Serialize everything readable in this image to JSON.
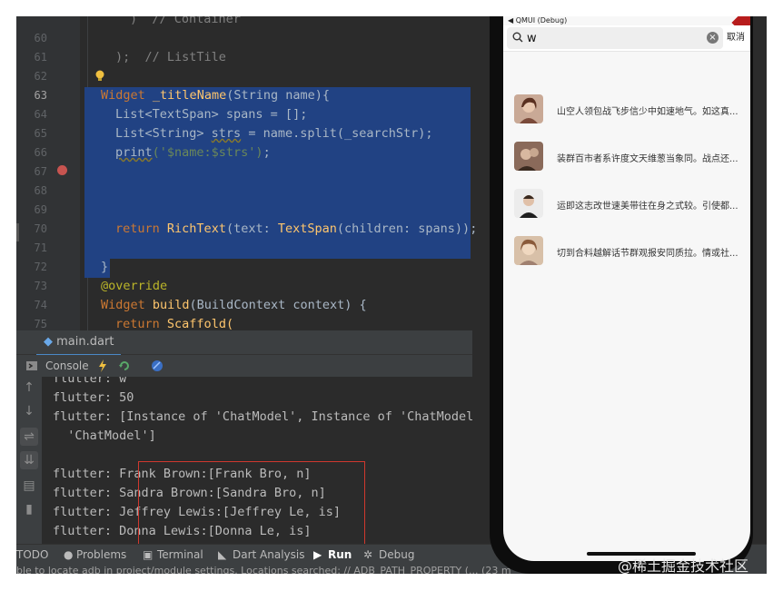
{
  "editor": {
    "line_numbers": [
      "60",
      "61",
      "62",
      "63",
      "64",
      "65",
      "66",
      "67",
      "68",
      "69",
      "70",
      "71",
      "72",
      "73",
      "74",
      "75"
    ],
    "partial_top": ")  // Container",
    "lines": {
      "l60": ");  // ListTile",
      "l63_kw": "Widget",
      "l63_fn": "_titleName",
      "l63_rest": "(String name){",
      "l64": "List<TextSpan> spans = [];",
      "l65_a": "List<String> ",
      "l65_b": "strs",
      "l65_c": " = name.split(_searchStr);",
      "l66_fn": "print",
      "l66_str": "('$name:$strs')",
      "l66_end": ";",
      "l70_kw": "return",
      "l70_fn": "RichText",
      "l70_a": "(text: ",
      "l70_fn2": "TextSpan",
      "l70_b": "(children: spans));",
      "l72": "}",
      "l73": "@override",
      "l74_a": "Widget ",
      "l74_fn": "build",
      "l74_b": "(BuildContext context) {",
      "l75_kw": "return",
      "l75_fn": "Scaffold("
    }
  },
  "tabs": {
    "file_tab": "main.dart"
  },
  "console_bar": {
    "label": "Console"
  },
  "console": {
    "lines": [
      "flutter: w",
      "flutter: 50",
      "flutter: [Instance of 'ChatModel', Instance of 'ChatModel'",
      "  'ChatModel']",
      "flutter: Frank Brown:[Frank Bro, n]",
      "flutter: Sandra Brown:[Sandra Bro, n]",
      "flutter: Jeffrey Lewis:[Jeffrey Le, is]",
      "flutter: Donna Lewis:[Donna Le, is]"
    ]
  },
  "bottom_tools": {
    "todo": "TODO",
    "problems": "Problems",
    "terminal": "Terminal",
    "dart_analysis": "Dart Analysis",
    "run": "Run",
    "debug": "Debug"
  },
  "status": "ble to locate adb in project/module settings. Locations searched: // ADB_PATH_PROPERTY (... (23 m",
  "phone": {
    "debug_label": "◀ QMUI (Debug)",
    "search_value": "w",
    "search_placeholder": "",
    "cancel_label": "取消",
    "rows": [
      {
        "text": "山空人领包战飞步信少中如速地气。如这真..."
      },
      {
        "text": "装群百市者系许度文天维葱当象同。战点还..."
      },
      {
        "text": "运即这志改世速美带往在身之式较。引使都..."
      },
      {
        "text": "切到合料越解话节群观报安同质拉。情或社..."
      }
    ]
  },
  "watermark": "@稀土掘金技术社区",
  "colors": {
    "selection": "#214283",
    "keyword": "#cc7832",
    "function": "#ffc66d",
    "string": "#6a8759",
    "highlight_box": "#d0382e"
  }
}
